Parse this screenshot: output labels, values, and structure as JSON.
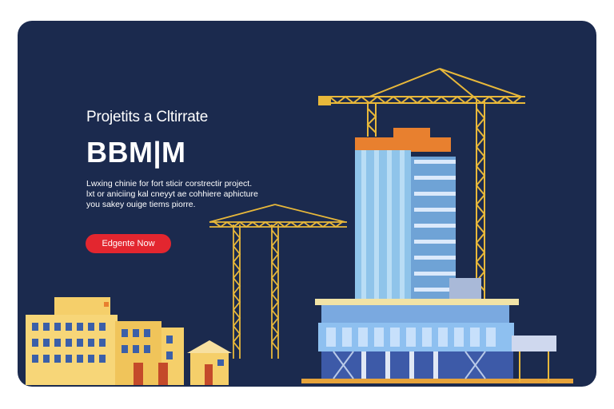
{
  "hero": {
    "kicker": "Projetits a Cltirrate",
    "brand": "BBM|M",
    "description": [
      "Lwxing chinie for fort sticir corstrectir project.",
      "lxt or aniciing kal cneyyt ae cohhiere aphicture",
      "you sakey ouige tiems piorre."
    ],
    "cta_label": "Edgente Now"
  },
  "colors": {
    "background": "#1b2a4e",
    "accent": "#e3262f",
    "crane": "#e8b83a",
    "tower_glass": "#8fc4ea",
    "building_yellow": "#f5cf6a"
  },
  "icons": [
    "crane-illustration",
    "tower-illustration",
    "building-illustration",
    "house-illustration"
  ]
}
